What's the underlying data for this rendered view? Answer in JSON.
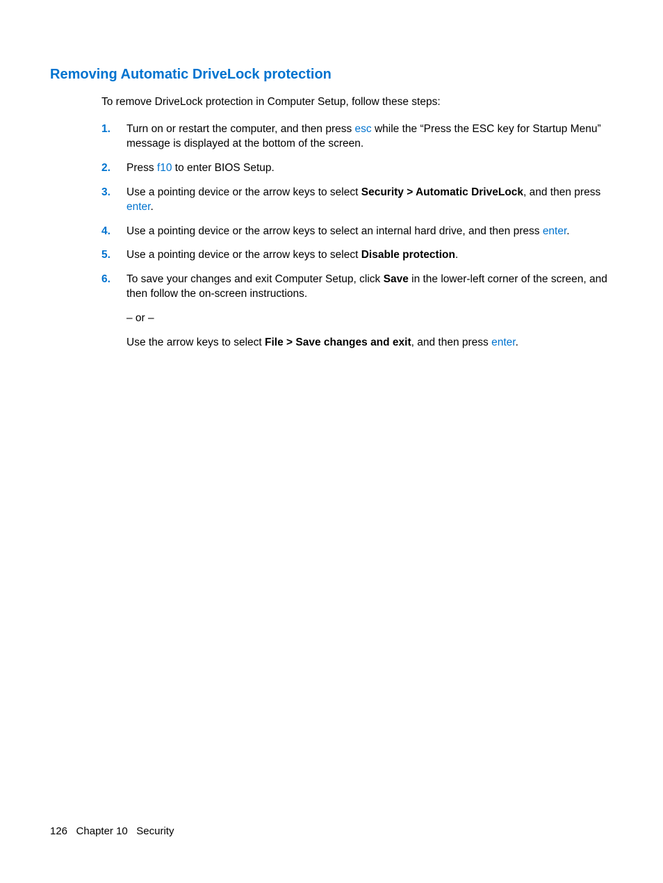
{
  "heading": "Removing Automatic DriveLock protection",
  "intro": "To remove DriveLock protection in Computer Setup, follow these steps:",
  "steps": {
    "n1": "1.",
    "s1a": "Turn on or restart the computer, and then press ",
    "s1key": "esc",
    "s1b": " while the “Press the ESC key for Startup Menu” message is displayed at the bottom of the screen.",
    "n2": "2.",
    "s2a": "Press ",
    "s2key": "f10",
    "s2b": " to enter BIOS Setup.",
    "n3": "3.",
    "s3a": "Use a pointing device or the arrow keys to select ",
    "s3bold": "Security > Automatic DriveLock",
    "s3b": ", and then press ",
    "s3key": "enter",
    "s3c": ".",
    "n4": "4.",
    "s4a": "Use a pointing device or the arrow keys to select an internal hard drive, and then press ",
    "s4key": "enter",
    "s4b": ".",
    "n5": "5.",
    "s5a": "Use a pointing device or the arrow keys to select ",
    "s5bold": "Disable protection",
    "s5b": ".",
    "n6": "6.",
    "s6a": "To save your changes and exit Computer Setup, click ",
    "s6bold": "Save",
    "s6b": " in the lower-left corner of the screen, and then follow the on-screen instructions.",
    "s6or": "– or –",
    "s6c": "Use the arrow keys to select ",
    "s6bold2": "File > Save changes and exit",
    "s6d": ", and then press ",
    "s6key": "enter",
    "s6e": "."
  },
  "footer": {
    "page": "126",
    "chapter": "Chapter 10",
    "title": "Security"
  }
}
